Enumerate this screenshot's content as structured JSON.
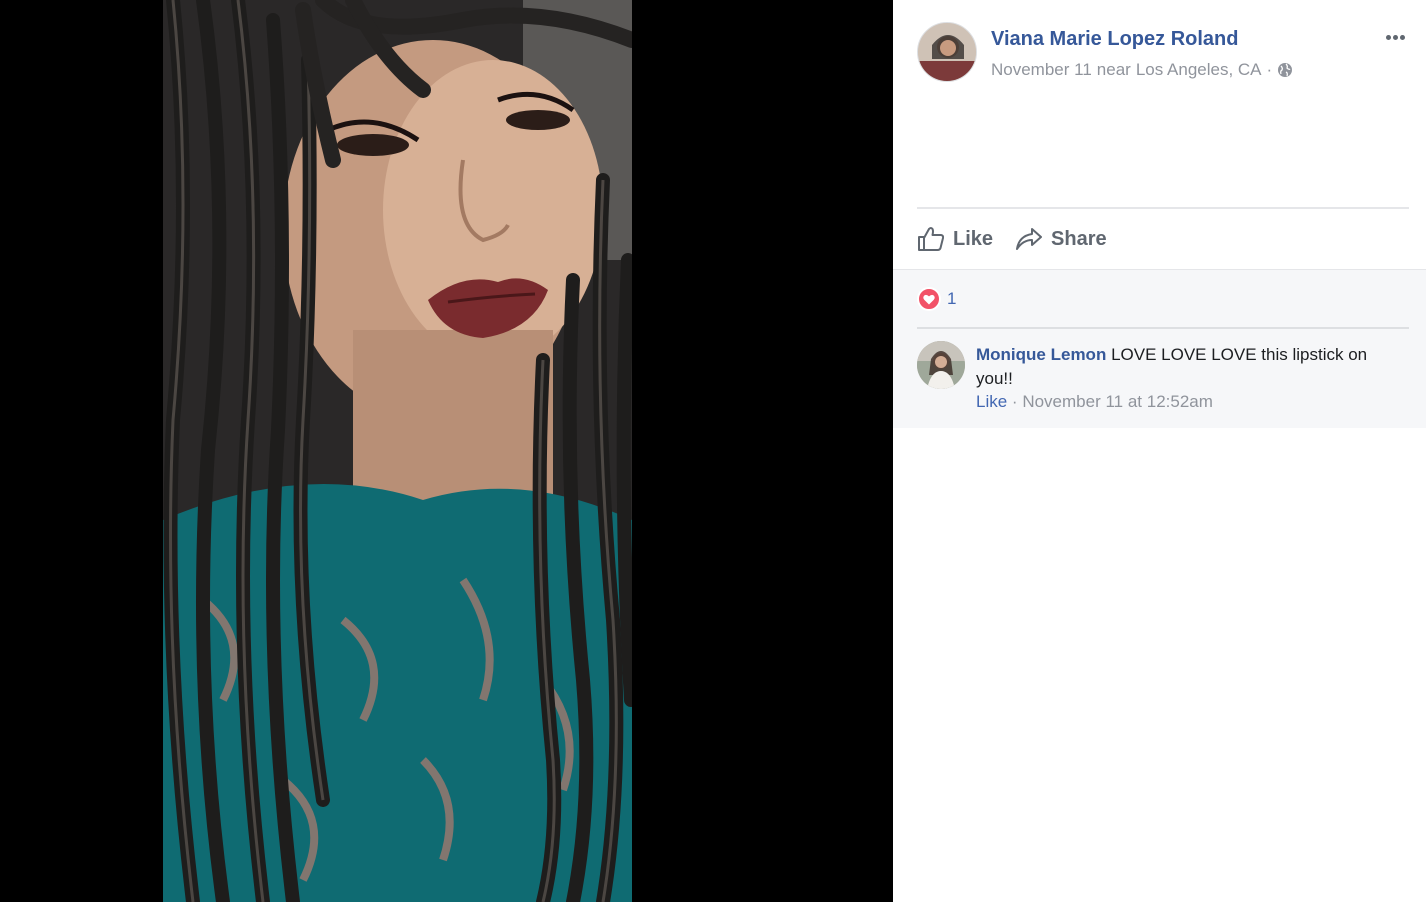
{
  "post": {
    "author": "Viana Marie Lopez Roland",
    "date": "November 11",
    "location_prefix": "near",
    "location": "Los Angeles, CA",
    "separator": "·",
    "privacy_icon": "globe-icon",
    "more_icon": "ellipsis-icon"
  },
  "actions": {
    "like_label": "Like",
    "share_label": "Share"
  },
  "reactions": {
    "type_icon": "love-icon",
    "count": "1"
  },
  "comments": [
    {
      "author": "Monique Lemon",
      "text": "LOVE LOVE LOVE this lipstick on you!!",
      "like_label": "Like",
      "separator": "·",
      "timestamp": "November 11 at 12:52am"
    }
  ],
  "colors": {
    "link_blue": "#365899",
    "meta_gray": "#90949c",
    "love_red": "#f25268",
    "comments_bg": "#f6f7f9"
  }
}
